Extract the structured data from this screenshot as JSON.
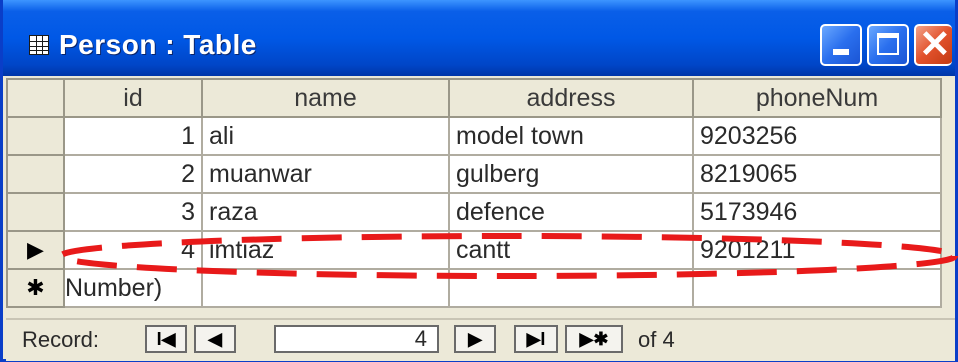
{
  "window": {
    "title": "Person : Table",
    "title_icon": "datasheet-icon",
    "buttons": [
      "minimize",
      "maximize",
      "close"
    ],
    "close_glyph": "✕"
  },
  "table": {
    "columns": [
      "id",
      "name",
      "address",
      "phoneNum"
    ],
    "rows": [
      {
        "id": "1",
        "name": "ali",
        "address": "model town",
        "phoneNum": "9203256"
      },
      {
        "id": "2",
        "name": "muanwar",
        "address": "gulberg",
        "phoneNum": "8219065"
      },
      {
        "id": "3",
        "name": "raza",
        "address": "defence",
        "phoneNum": "5173946"
      },
      {
        "id": "4",
        "name": "imtiaz",
        "address": "cantt",
        "phoneNum": "9201211"
      }
    ],
    "current_row_marker": "▶",
    "new_row_marker": "✱",
    "new_row_id_placeholder": "Number)"
  },
  "footer": {
    "record_label": "Record:",
    "current_record": "4",
    "of_label": "of 4",
    "nav": {
      "first": "I◀",
      "prev": "◀",
      "next": "▶",
      "last": "▶I",
      "new": "▶✱"
    }
  },
  "highlight": {
    "color": "#e81a1a",
    "target": "row-4"
  },
  "colors": {
    "titlebar": "#0058e6",
    "close_button": "#e2522c",
    "chrome": "#ece9d8"
  }
}
